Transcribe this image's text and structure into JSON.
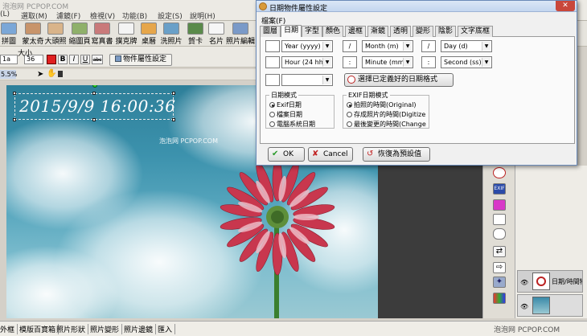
{
  "menubar": {
    "items": [
      "(L)",
      "選取(M)",
      "濾鏡(F)",
      "檢視(V)",
      "功能(B)",
      "設定(S)",
      "說明(H)"
    ]
  },
  "toolbar": {
    "buttons": [
      "拼圖",
      "蒙太奇",
      "大頭照",
      "縮圖頁",
      "寫真書",
      "撲克牌",
      "桌曆",
      "洗照片",
      "賀卡",
      "名片",
      "照片編輯"
    ]
  },
  "format_bar": {
    "size_label": "大小",
    "size_value": "36",
    "font_value": "1a",
    "bold": "B",
    "italic": "I",
    "underline": "U",
    "strike": "abc",
    "properties_button": "物件屬性設定"
  },
  "zoom": {
    "value": "5.5%"
  },
  "canvas": {
    "date_text": "2015/9/9 16:00:36"
  },
  "watermarks": {
    "top_left": "泡泡网 PCPOP.COM",
    "mid": "泡泡网 PCPOP.COM",
    "bottom_right": "泡泡网 PCPOP.COM"
  },
  "dialog": {
    "title": "日期物件屬性設定",
    "close_label": "✕",
    "menu": "檔案(F)",
    "tabs": [
      "圖層",
      "日期",
      "字型",
      "顏色",
      "邊框",
      "漸鏡",
      "透明",
      "變形",
      "陰影",
      "文字底框"
    ],
    "active_tab": "日期",
    "row1": {
      "year": "Year (yyyy)",
      "sep1": "/",
      "month": "Month (m)",
      "sep2": "/",
      "day": "Day (d)"
    },
    "row2": {
      "hour": "Hour (24 hh)",
      "sep1": ":",
      "minute": "Minute (mm)",
      "sep2": ":",
      "second": "Second (ss)"
    },
    "preset_button": "選擇已定義好的日期格式",
    "date_mode": {
      "title": "日期模式",
      "options": [
        "Exif日期",
        "檔案日期",
        "電腦系統日期"
      ],
      "selected": 0
    },
    "exif_mode": {
      "title": "EXIF日期模式",
      "options": [
        "拍照的時間(Original)",
        "存成照片的時間(Digitize",
        "最後變更的時間(Change"
      ],
      "selected": 0
    },
    "buttons": {
      "ok": "OK",
      "cancel": "Cancel",
      "restore": "恢復為預設值"
    }
  },
  "layers_panel": {
    "items": [
      "日期/時間物",
      ""
    ]
  },
  "bottom_tabs": [
    "外框",
    "模版百寶箱",
    "照片形狀",
    "照片變形",
    "照片邊鏡",
    "匯入"
  ],
  "colors": {
    "accent_red": "#e02020",
    "dialog_title_bg": "#c3d6ef",
    "close_button": "#c9473b",
    "ok_check": "#2a9a2a",
    "cancel_x": "#c02020"
  },
  "icons": [
    "shield-dialog-icon",
    "checkmark-icon",
    "x-icon",
    "restore-icon",
    "clock-icon",
    "exif-icon",
    "cake-icon",
    "calendar-icon",
    "speech-bubble-icon",
    "arrows-icon",
    "arrow-right-icon",
    "star-icon",
    "gradient-icon",
    "eye-icon"
  ]
}
